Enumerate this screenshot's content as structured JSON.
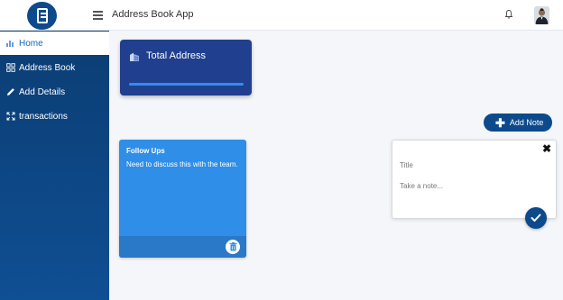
{
  "header": {
    "app_title": "Address Book App"
  },
  "sidebar": {
    "items": [
      {
        "label": "Home",
        "icon": "bar-chart-icon",
        "active": true
      },
      {
        "label": "Address Book",
        "icon": "grid-icon",
        "active": false
      },
      {
        "label": "Add Details",
        "icon": "pencil-icon",
        "active": false
      },
      {
        "label": "transactions",
        "icon": "expand-icon",
        "active": false
      }
    ]
  },
  "total_card": {
    "title": "Total Address",
    "icon": "building-icon"
  },
  "note": {
    "title": "Follow Ups",
    "text": "Need to discuss this with the team."
  },
  "add_note": {
    "button_label": "Add Note",
    "title_placeholder": "Title",
    "body_placeholder": "Take a note..."
  },
  "colors": {
    "primary": "#0d4a8c",
    "card_blue": "#213f8f",
    "note_blue": "#2f8ee8",
    "sidebar_top": "#0b3d73"
  }
}
